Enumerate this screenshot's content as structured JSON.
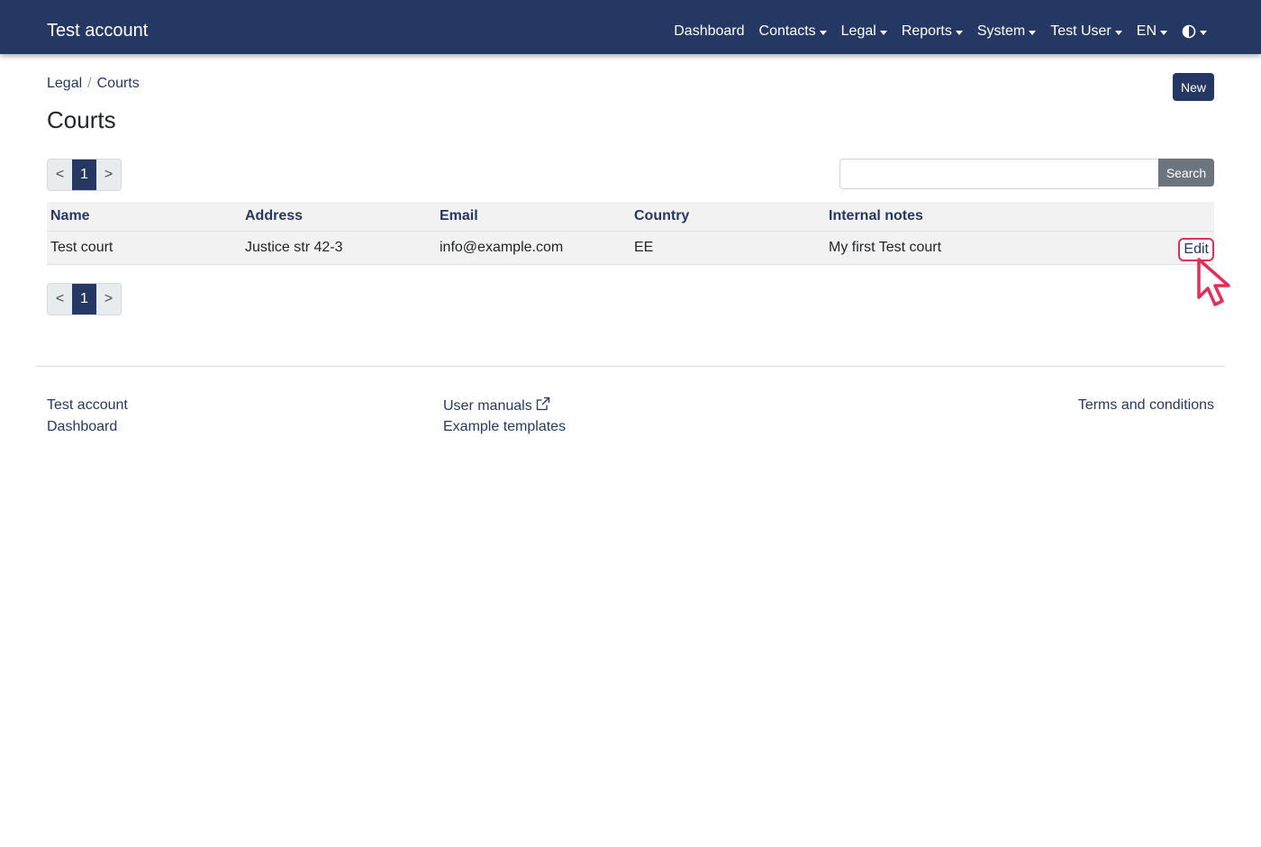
{
  "navbar": {
    "brand": "Test account",
    "items": [
      {
        "label": "Dashboard",
        "dropdown": false
      },
      {
        "label": "Contacts",
        "dropdown": true
      },
      {
        "label": "Legal",
        "dropdown": true
      },
      {
        "label": "Reports",
        "dropdown": true
      },
      {
        "label": "System",
        "dropdown": true
      },
      {
        "label": "Test User",
        "dropdown": true
      },
      {
        "label": "EN",
        "dropdown": true
      }
    ],
    "theme_icon": "contrast-icon",
    "background": "#253864"
  },
  "breadcrumb": {
    "items": [
      "Legal",
      "Courts"
    ]
  },
  "page": {
    "title": "Courts",
    "new_label": "New"
  },
  "pagination": {
    "prev": "<",
    "current": "1",
    "next": ">"
  },
  "search": {
    "value": "",
    "placeholder": "",
    "button_label": "Search"
  },
  "table": {
    "columns": [
      "Name",
      "Address",
      "Email",
      "Country",
      "Internal notes"
    ],
    "rows": [
      {
        "name": "Test court",
        "address": "Justice str 42-3",
        "email": "info@example.com",
        "country": "EE",
        "notes": "My first Test court",
        "action": "Edit"
      }
    ]
  },
  "footer": {
    "col1": [
      "Test account",
      "Dashboard"
    ],
    "col2": [
      "User manuals",
      "Example templates"
    ],
    "col3": [
      "Terms and conditions"
    ],
    "external_icon": "external-link-icon"
  },
  "colors": {
    "primary": "#253864",
    "secondary": "#6c757d",
    "highlight": "#e0305a"
  }
}
